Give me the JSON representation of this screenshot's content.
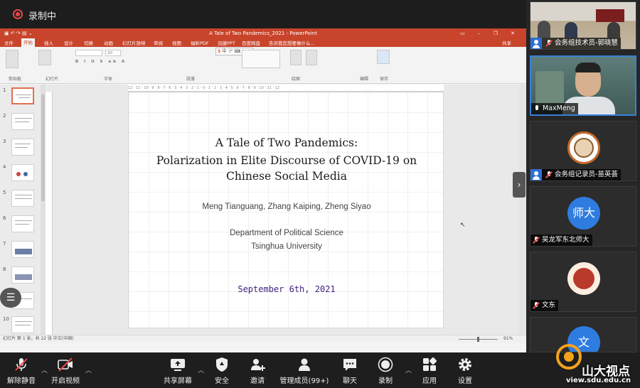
{
  "recording": {
    "label": "录制中"
  },
  "ppt": {
    "window_title": "A Tale of Two Pandemics_2021 - PowerPoint",
    "tabs": [
      "文件",
      "开始",
      "插入",
      "设计",
      "切换",
      "动画",
      "幻灯片放映",
      "审阅",
      "视图",
      "福昕PDF",
      "迅捷PPT",
      "百度网盘",
      "告诉我您想要做什么..."
    ],
    "active_tab": "开始",
    "share_label": "共享",
    "ribbon_groups": [
      "剪贴板",
      "幻灯片",
      "字体",
      "段落",
      "绘图",
      "编辑",
      "保存"
    ],
    "font_size": "20",
    "ime_label": "中",
    "ruler_marks": "12 · 11 · 10 · 9 · 8 · 7 · 6 · 5 · 4 · 3 · 2 · 1 · 0 · 1 · 2 · 3 · 4 · 5 · 6 · 7 · 8 · 9 · 10 · 11 · 12",
    "slide_numbers": [
      "1",
      "2",
      "3",
      "4",
      "5",
      "6",
      "7",
      "8",
      "9",
      "10"
    ],
    "status_left": "幻灯片 第 1 张，共 22 张   中文(中国)",
    "zoom": "91%"
  },
  "slide": {
    "title_line1": "A Tale of Two Pandemics:",
    "title_line2": "Polarization in Elite Discourse of COVID-19 on",
    "title_line3": "Chinese Social Media",
    "authors": "Meng Tianguang, Zhang Kaiping, Zheng Siyao",
    "department": "Department of Political Science",
    "university": "Tsinghua University",
    "date": "September 6th, 2021"
  },
  "participants": [
    {
      "name": "会务组技术员-郭晓慧",
      "mic": "muted",
      "host": true
    },
    {
      "name": "MaxMeng",
      "mic": "active",
      "host": false
    },
    {
      "name": "会务组记录员-苗英荟",
      "mic": "muted",
      "host": true
    },
    {
      "name": "吴龙军东北师大",
      "mic": "muted",
      "host": false,
      "avatar_text": "师大"
    },
    {
      "name": "文东",
      "mic": "muted",
      "host": false
    },
    {
      "avatar_text": "文"
    }
  ],
  "toolbar": {
    "unmute": "解除静音",
    "start_video": "开启视频",
    "share_screen": "共享屏幕",
    "security": "安全",
    "invite": "邀请",
    "manage_members": "管理成员(99+)",
    "chat": "聊天",
    "record": "录制",
    "apps": "应用",
    "settings": "设置"
  },
  "watermark": {
    "text": "山大视点",
    "url": "view.sdu.edu.cn"
  },
  "colors": {
    "ppt_accent": "#c8442b",
    "recording_red": "#e54848",
    "active_speaker": "#3a7fd6",
    "date_purple": "#3d1f7e",
    "avatar_blue": "#2f7ce0"
  }
}
